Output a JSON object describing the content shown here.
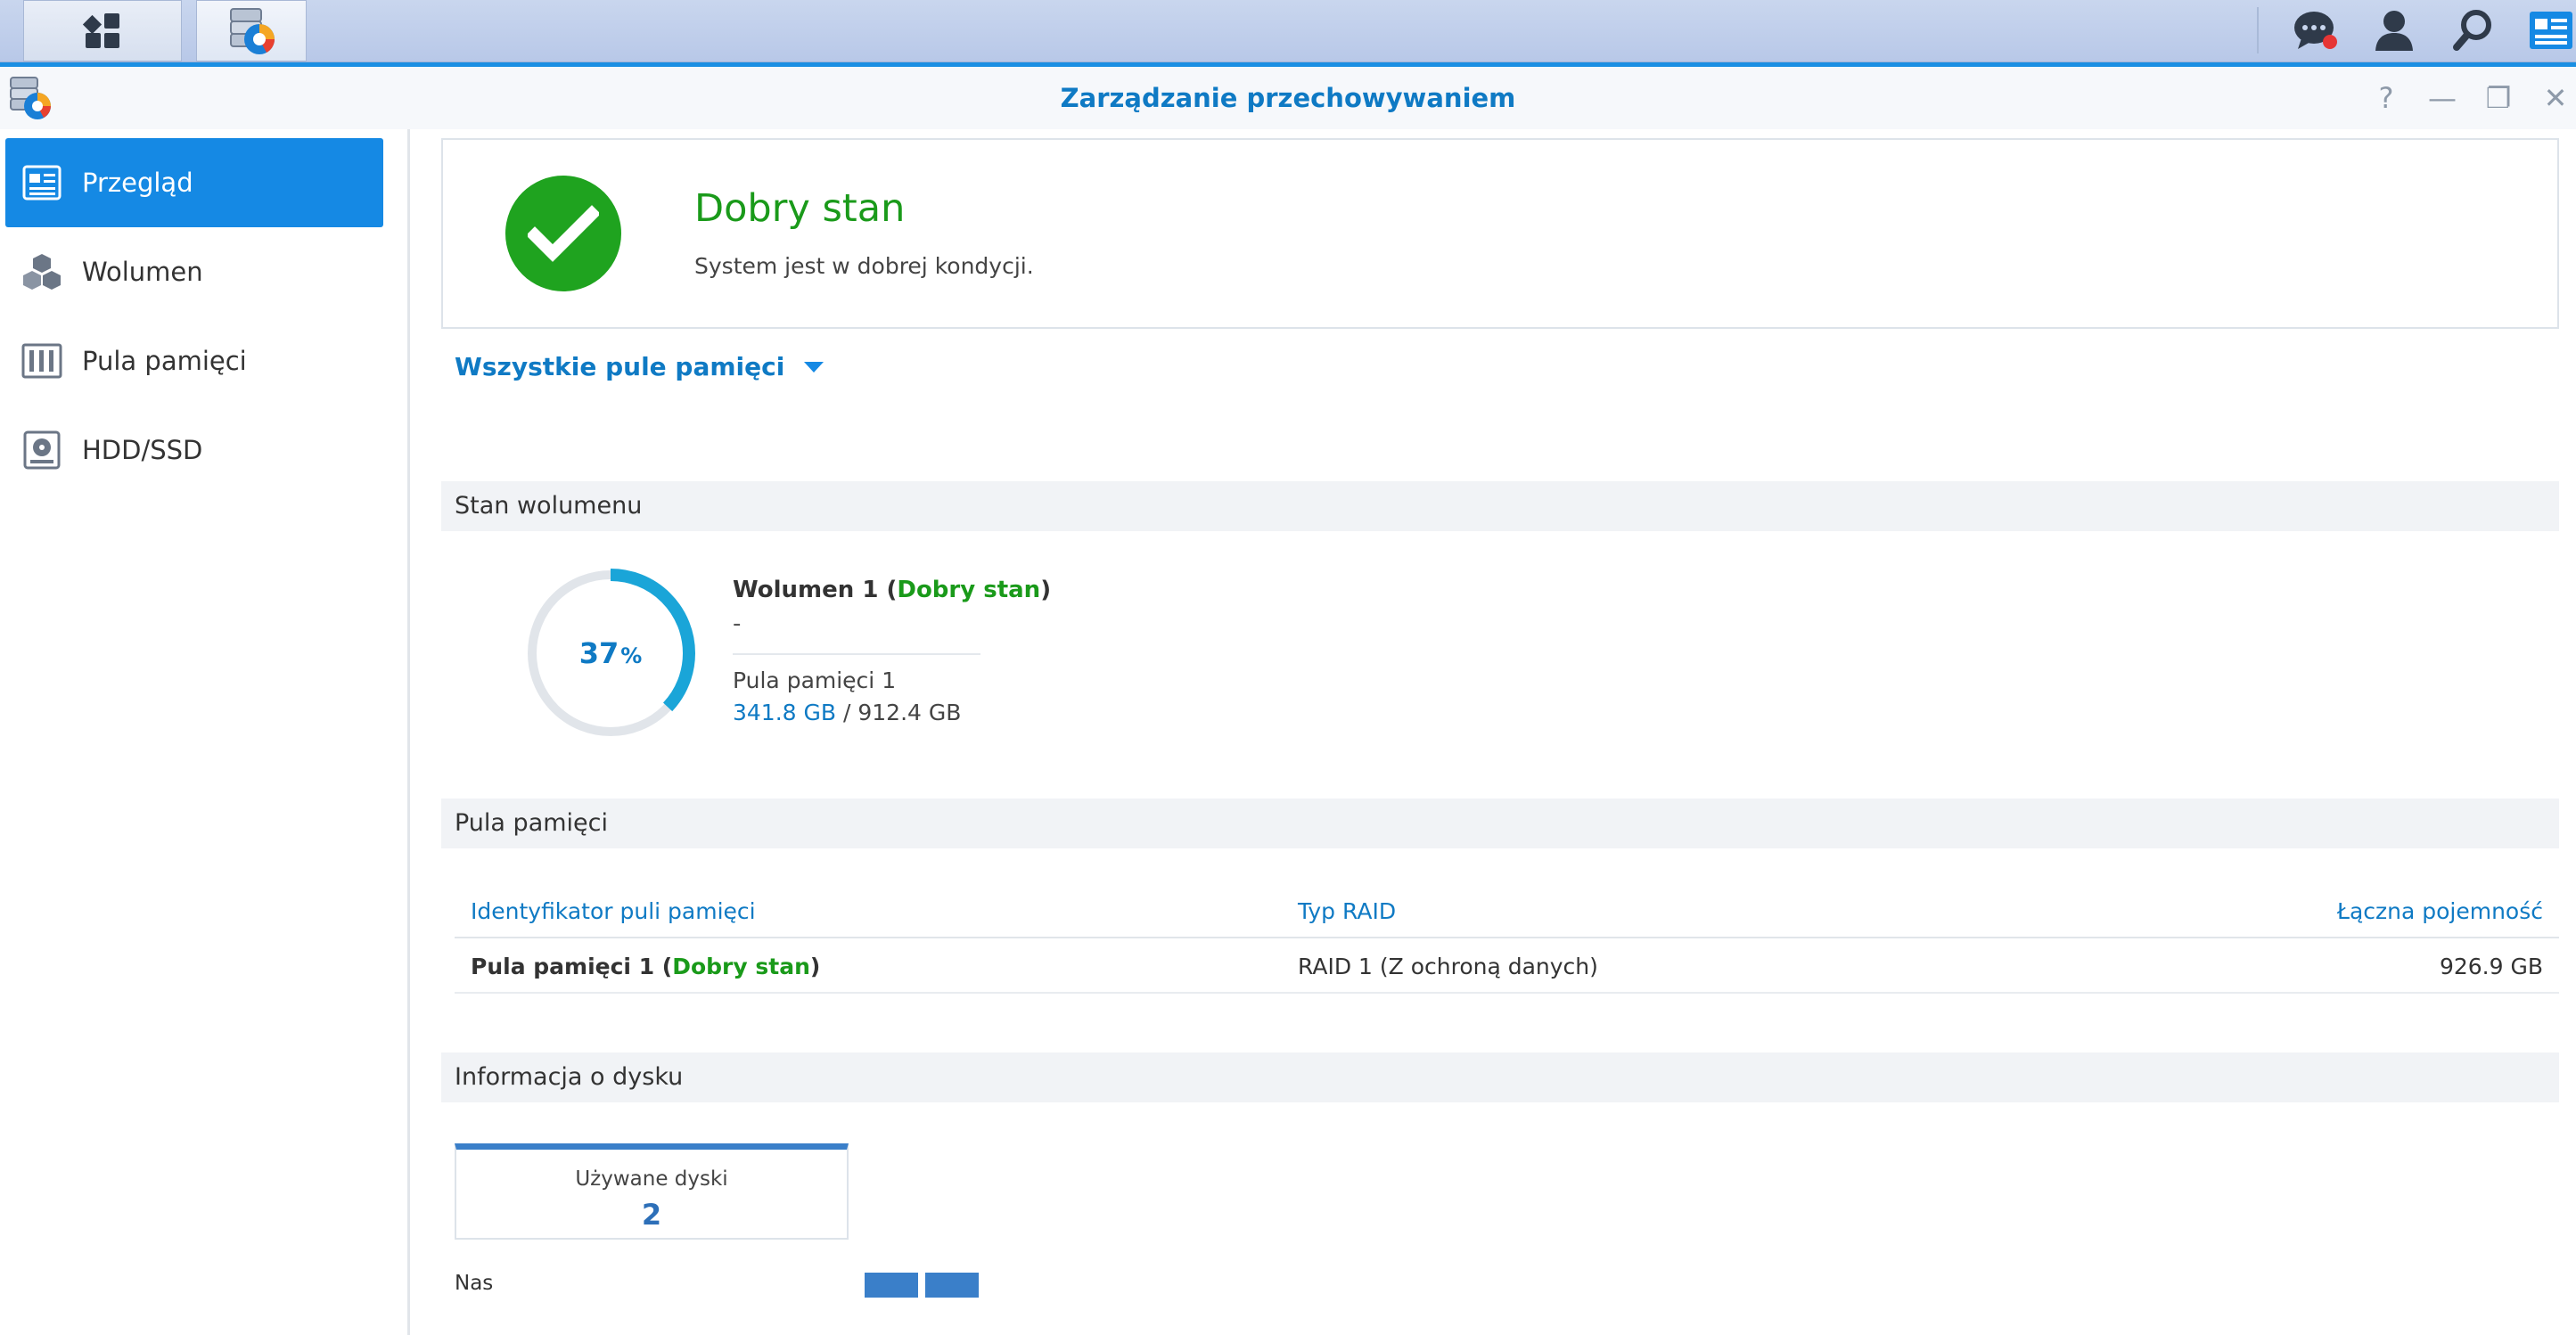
{
  "taskbar": {
    "main_menu_icon": "grid-icon",
    "storage_icon": "storage-manager-icon",
    "notifications_icon": "chat-bubble-icon",
    "notification_badge_color": "#e63535",
    "user_icon": "user-icon",
    "search_icon": "search-icon",
    "widgets_icon": "widgets-icon"
  },
  "window": {
    "title": "Zarządzanie przechowywaniem",
    "controls": {
      "help": "?",
      "minimize": "—",
      "restore": "❐",
      "close": "✕"
    }
  },
  "sidebar": {
    "items": [
      {
        "label": "Przegląd",
        "icon": "overview-icon",
        "active": true
      },
      {
        "label": "Wolumen",
        "icon": "volume-cubes-icon",
        "active": false
      },
      {
        "label": "Pula pamięci",
        "icon": "storage-pool-icon",
        "active": false
      },
      {
        "label": "HDD/SSD",
        "icon": "hdd-icon",
        "active": false
      }
    ]
  },
  "status": {
    "title": "Dobry stan",
    "description": "System jest w dobrej kondycji.",
    "icon": "check-icon",
    "color": "#1fa31f"
  },
  "pool_selector": {
    "label": "Wszystkie pule pamięci"
  },
  "sections": {
    "volume_status": "Stan wolumenu",
    "storage_pool": "Pula pamięci",
    "disk_info": "Informacja o dysku"
  },
  "volume": {
    "name_prefix": "Wolumen 1 (",
    "state": "Dobry stan",
    "name_suffix": ")",
    "dash": "-",
    "pool": "Pula pamięci 1",
    "used": "341.8 GB",
    "separator": " / ",
    "total": "912.4 GB",
    "usage_percent_value": "37",
    "usage_percent_sign": "%",
    "usage_fraction": 0.37
  },
  "pool_table": {
    "headers": [
      "Identyfikator puli pamięci",
      "Typ RAID",
      "Łączna pojemność"
    ],
    "rows": [
      {
        "id_prefix": "Pula pamięci 1 (",
        "state": "Dobry stan",
        "id_suffix": ")",
        "raid": "RAID 1 (Z ochroną danych)",
        "capacity": "926.9 GB"
      }
    ]
  },
  "disk_info": {
    "used_disks_label": "Używane dyski",
    "used_disks_value": "2",
    "nas_label": "Nas",
    "slots": 2
  }
}
